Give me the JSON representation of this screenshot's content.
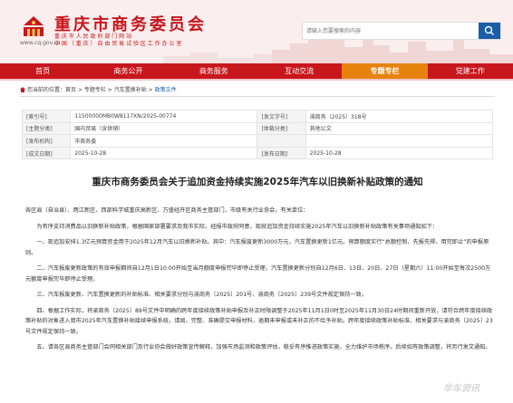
{
  "header": {
    "site_title": "重庆市商务委员会",
    "site_sub_1": "重 庆 市 人 民 政 府 部 门 网 站",
    "site_sub_2": "中 国 （ 重 庆 ） 自 由 贸 易 试 验 区 工 作 办 公 室",
    "site_url": "www.cq.gov.cn",
    "search_placeholder": "请输入您要搜索的内容"
  },
  "nav": [
    "首页",
    "商务公开",
    "商务服务",
    "互动交流",
    "专题专栏",
    "党建工作"
  ],
  "nav_active_index": 4,
  "breadcrumb": {
    "label": "您当前的位置：",
    "items": [
      "首页",
      "专题专栏",
      "汽车置换补贴"
    ],
    "current": "政策文件",
    "sep": " > "
  },
  "info": [
    [
      "[索引号]",
      "11500000MB0W8117XN/2025-00774",
      "[发文字号]",
      "渝商务〔2025〕318号"
    ],
    [
      "[主题分类]",
      "国内贸易（含供销）",
      "[体裁分类]",
      "其他公文"
    ],
    [
      "[发布机构]",
      "市商务委",
      "",
      ""
    ],
    [
      "[成文日期]",
      "2025-10-28",
      "[发布日期]",
      "2025-10-28"
    ]
  ],
  "doc_title": "重庆市商务委员会关于追加资金持续实施2025年汽车以旧换新补贴政策的通知",
  "body": {
    "addressee": "各区县（自治县）、两江新区、西部科学城重庆高新区、万盛经开区商务主管部门，市级有关行业协会，有关单位：",
    "intro": "为有序支持消费品以旧换新补贴政策，根据国家部署要求及我市实际，经报市政府同意，现就追加资金持续实施2025年汽车以旧换新补贴政策有关事项通知如下：",
    "p1": "一、现追加安排1.3亿元预算资金用于2025年12月汽车以旧换新补贴。其中：汽车报废更新3000万元，汽车置换更新1亿元。预算额度实行“总额控制、先报先得、用完即止”的申报原则。",
    "p2": "二、汽车报废更新政策的有效申报期间自12月1日10:00开始至当月额度申报完毕即停止受理，汽车置换更新分别自12月6日、13日、20日、27日（星期六）11:00开始至每次2500万元额度申报完毕即停止受理。",
    "p3": "三、汽车报废更新、汽车置换更新的补贴标准、相关要求分别与渝商务〔2025〕201号、渝商务〔2025〕239号文件规定保持一致。",
    "p4": "四、根据工作实际，将渝商务〔2025〕89号文件中明确的跨年度接续政策补贴申报及补正时限调整于2025年11月1日0时至2025年11月30日24时期间重新开放，请符合跨年度接续政策补贴的对象进入我市2025年汽车置换补贴接续申报系统，请阅、完整、准确提交申报材料，逾期未申报或未补正的不给予补贴。跨年度接续政策补贴标准、相关要求与渝商务〔2025〕23号文件规定保持一致。",
    "p5": "五、请各区县商务主管部门会同相关部门及行业协会做好政策宣传解释，加强市场监测和政策评估，稳妥有序推进政策实施，全力维护市场秩序。后续如有政策调整，将另行发文通知。"
  },
  "watermark": "华车资讯",
  "colors": {
    "brand_red": "#c8161d",
    "nav_active": "#e6830f",
    "search_blue": "#1a5ea8"
  }
}
